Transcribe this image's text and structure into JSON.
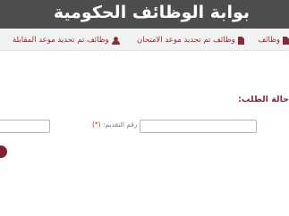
{
  "header": {
    "title": "بوابة الوظائف الحكومية"
  },
  "nav": {
    "items": [
      {
        "label": "وظائف",
        "icon": "file-icon"
      },
      {
        "label": "وظائف تم تحديد موعد الامتحان",
        "icon": "file-icon"
      },
      {
        "label": "وظائف تم تحديد موعد المقابلة",
        "icon": "user-icon"
      }
    ]
  },
  "form": {
    "status_label": "حالة الطلب:",
    "application_number_label": "رقم التقديم:",
    "required_marker": "(*)",
    "application_number_value": "",
    "secondary_value": ""
  },
  "colors": {
    "header_bg": "#4d4d4d",
    "accent": "#8a2a36",
    "button": "#7e2430"
  }
}
